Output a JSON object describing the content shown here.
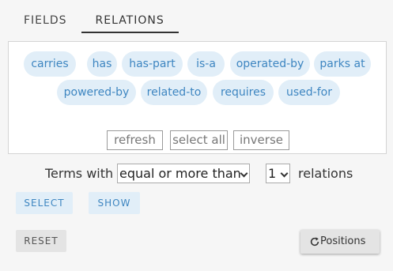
{
  "tabs": [
    {
      "label": "FIELDS",
      "active": false
    },
    {
      "label": "RELATIONS",
      "active": true
    }
  ],
  "relations": [
    "carries",
    "has",
    "has-part",
    "is-a",
    "operated-by",
    "parks at",
    "powered-by",
    "related-to",
    "requires",
    "used-for"
  ],
  "panel_buttons": {
    "refresh": "refresh",
    "select_all": "select all",
    "inverse": "inverse"
  },
  "filter": {
    "prefix": "Terms with",
    "mode": "equal or more than",
    "count": "1",
    "suffix": "relations"
  },
  "actions": {
    "select": "SELECT",
    "show": "SHOW",
    "reset": "RESET",
    "positions": "Positions"
  },
  "colors": {
    "chip_bg": "#e1eef8",
    "chip_text": "#3e86c1",
    "page_bg": "#f6f6f6"
  }
}
